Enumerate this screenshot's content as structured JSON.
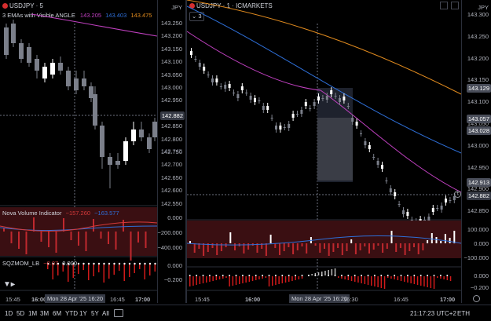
{
  "left_panel": {
    "symbol": "USDJPY · 5",
    "indicator_name": "3 EMAs with Visible ANGLE",
    "ema_values": [
      "143.205",
      "143.403",
      "143.475"
    ],
    "ema_colors": [
      "#c040c0",
      "#2e6fd8",
      "#e08a1e"
    ],
    "currency": "JPY",
    "price_ticks": [
      "143.250",
      "143.200",
      "143.150",
      "143.100",
      "143.050",
      "143.000",
      "142.950",
      "142.900",
      "142.850",
      "142.800",
      "142.750",
      "142.700",
      "142.650",
      "142.600",
      "142.550"
    ],
    "last_price": "142.882",
    "crosshair_price": "142.745",
    "volume_indicator": {
      "name": "Nova Volume Indicator",
      "value1": "−157.260",
      "value2": "−163.577",
      "ticks": [
        "0.000",
        "−200.000",
        "−400.000"
      ]
    },
    "sqz": {
      "name": "SQZMOM_LB",
      "v1": "−0.07",
      "v2": "0.000",
      "ticks": [
        "0.000",
        "−0.200"
      ]
    },
    "time_labels": [
      "15:45",
      "16:00",
      "16:45",
      "17:00"
    ],
    "crosshair_time": "Mon 28 Apr '25  16:20"
  },
  "right_panel": {
    "symbol": "USDJPY · 1 · ICMARKETS",
    "badge": "3",
    "currency": "JPY",
    "price_ticks": [
      "143.300",
      "143.250",
      "143.200",
      "143.150",
      "143.100",
      "143.050",
      "143.000",
      "142.950",
      "142.900",
      "142.850"
    ],
    "price_boxes": [
      {
        "value": "143.129",
        "color": "#4a4e5a"
      },
      {
        "value": "143.057",
        "color": "#4a4e5a"
      },
      {
        "value": "143.028",
        "color": "#4a4e5a"
      },
      {
        "value": "142.913",
        "color": "#4a4e5a"
      },
      {
        "value": "142.882",
        "color": "#363a45"
      }
    ],
    "volume_ticks": [
      "100.000",
      "0.000",
      "−100.000"
    ],
    "sqz_ticks": [
      "0.000",
      "−0.200"
    ],
    "time_labels": [
      "15:45",
      "16:00",
      "16:30",
      "16:45",
      "17:00"
    ],
    "crosshair_time": "Mon 28 Apr '25  16:20"
  },
  "bottom_bar": {
    "timeframes": [
      "1D",
      "5D",
      "1M",
      "3M",
      "6M",
      "YTD",
      "1Y",
      "5Y",
      "All"
    ],
    "clock": "21:17:23 UTC+2",
    "session": "ETH",
    "scale_pct": "%",
    "scale_log": "log",
    "scale_auto": "auto"
  },
  "colors": {
    "up": "#ffffff",
    "down": "#7b7f8a",
    "vol_bg": "#3a0f12",
    "vol_bar": "#c0282e",
    "sqz_bar": "#d01a1a"
  }
}
